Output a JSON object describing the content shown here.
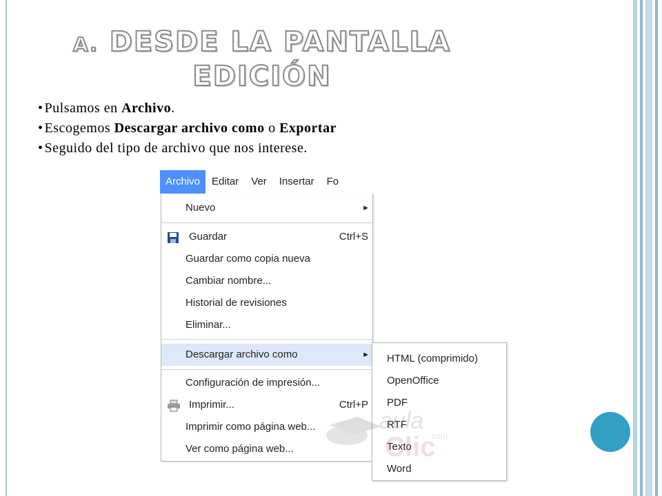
{
  "slide": {
    "title_prefix": "A.",
    "title_line1": "DESDE LA PANTALLA",
    "title_line2": "EDICIÓN",
    "bullets": [
      {
        "pre": "Pulsamos en ",
        "bold": "Archivo",
        "post": "."
      },
      {
        "pre": "Escogemos ",
        "bold": "Descargar archivo como",
        "mid": " o ",
        "bold2": "Exportar"
      },
      {
        "pre": "Seguido del tipo de archivo que nos interese."
      }
    ]
  },
  "menubar": {
    "items": [
      "Archivo",
      "Editar",
      "Ver",
      "Insertar",
      "Fo"
    ]
  },
  "file_menu": {
    "nuevo": "Nuevo",
    "guardar": "Guardar",
    "guardar_shortcut": "Ctrl+S",
    "guardar_copia": "Guardar como copia nueva",
    "cambiar_nombre": "Cambiar nombre...",
    "historial": "Historial de revisiones",
    "eliminar": "Eliminar...",
    "descargar": "Descargar archivo como",
    "configuracion": "Configuración de impresión...",
    "imprimir": "Imprimir...",
    "imprimir_shortcut": "Ctrl+P",
    "imprimir_web": "Imprimir como página web...",
    "ver_web": "Ver como página web...",
    "submenu_arrow": "►"
  },
  "download_submenu": {
    "items": [
      "HTML (comprimido)",
      "OpenOffice",
      "PDF",
      "RTF",
      "Texto",
      "Word"
    ]
  },
  "watermark": {
    "text1": "aula",
    "text2": "Clic",
    "text3": ".com"
  },
  "colors": {
    "accent": "#4d90fe",
    "highlight": "#dde8f8",
    "frame": "#9fc3d6",
    "circle": "#31a0c4"
  }
}
